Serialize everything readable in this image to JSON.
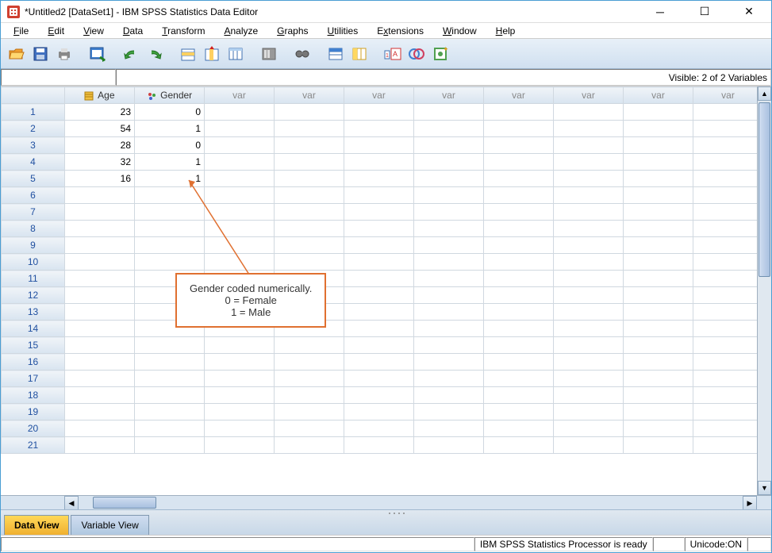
{
  "window": {
    "title": "*Untitled2 [DataSet1] - IBM SPSS Statistics Data Editor"
  },
  "menu": {
    "file": "File",
    "edit": "Edit",
    "view": "View",
    "data": "Data",
    "transform": "Transform",
    "analyze": "Analyze",
    "graphs": "Graphs",
    "utilities": "Utilities",
    "extensions": "Extensions",
    "window": "Window",
    "help": "Help"
  },
  "visible": "Visible: 2 of 2 Variables",
  "columns": {
    "age": "Age",
    "gender": "Gender",
    "var": "var"
  },
  "rows": [
    {
      "n": "1",
      "age": "23",
      "gender": "0"
    },
    {
      "n": "2",
      "age": "54",
      "gender": "1"
    },
    {
      "n": "3",
      "age": "28",
      "gender": "0"
    },
    {
      "n": "4",
      "age": "32",
      "gender": "1"
    },
    {
      "n": "5",
      "age": "16",
      "gender": "1"
    },
    {
      "n": "6"
    },
    {
      "n": "7"
    },
    {
      "n": "8"
    },
    {
      "n": "9"
    },
    {
      "n": "10"
    },
    {
      "n": "11"
    },
    {
      "n": "12"
    },
    {
      "n": "13"
    },
    {
      "n": "14"
    },
    {
      "n": "15"
    },
    {
      "n": "16"
    },
    {
      "n": "17"
    },
    {
      "n": "18"
    },
    {
      "n": "19"
    },
    {
      "n": "20"
    },
    {
      "n": "21"
    }
  ],
  "tabs": {
    "dataview": "Data View",
    "varview": "Variable View"
  },
  "status": {
    "processor": "IBM SPSS Statistics Processor is ready",
    "unicode": "Unicode:ON"
  },
  "annotation": {
    "line1": "Gender coded numerically.",
    "line2": "0 = Female",
    "line3": "1 = Male"
  }
}
